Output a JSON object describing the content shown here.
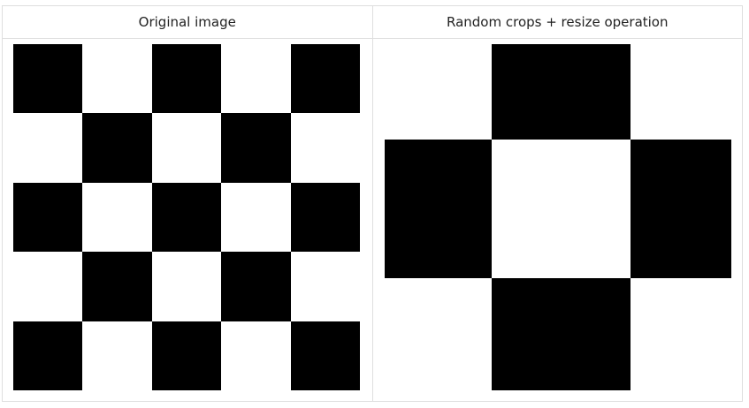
{
  "table": {
    "headers": [
      "Original image",
      "Random crops + resize operation"
    ]
  },
  "colors": {
    "dark": "#000000",
    "light": "#ffffff",
    "border": "#dedede"
  },
  "original": {
    "rows": 5,
    "cols": 5,
    "pattern": [
      [
        1,
        0,
        1,
        0,
        1
      ],
      [
        0,
        1,
        0,
        1,
        0
      ],
      [
        1,
        0,
        1,
        0,
        1
      ],
      [
        0,
        1,
        0,
        1,
        0
      ],
      [
        1,
        0,
        1,
        0,
        1
      ]
    ]
  },
  "cropped": {
    "rows": 3,
    "cols": 3,
    "pattern": [
      [
        0,
        1,
        0
      ],
      [
        1,
        0,
        1
      ],
      [
        0,
        1,
        0
      ]
    ]
  }
}
